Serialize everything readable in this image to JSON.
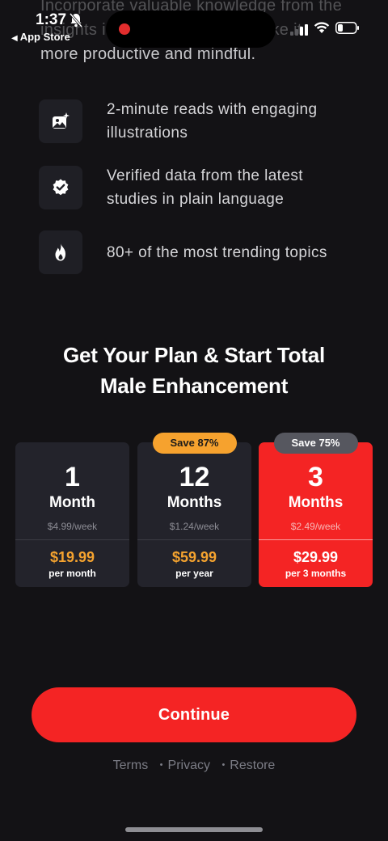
{
  "status_bar": {
    "time": "1:37",
    "back_app": "App Store"
  },
  "intro": {
    "line_top": "Incorporate valuable knowledge from the",
    "line_mid": "insights i                              ake it",
    "line_bottom": "more productive and mindful."
  },
  "features": [
    {
      "icon": "sparkle-image-icon",
      "text": "2-minute reads with engaging illustrations"
    },
    {
      "icon": "verified-badge-icon",
      "text": "Verified data from the latest studies in plain language"
    },
    {
      "icon": "fire-icon",
      "text": "80+ of the most trending topics"
    }
  ],
  "plan_title": {
    "line1": "Get Your Plan & Start Total",
    "line2": "Male Enhancement"
  },
  "plans": [
    {
      "number": "1",
      "unit": "Month",
      "weekly": "$4.99/week",
      "price": "$19.99",
      "period": "per month",
      "badge": "",
      "selected": false
    },
    {
      "number": "12",
      "unit": "Months",
      "weekly": "$1.24/week",
      "price": "$59.99",
      "period": "per year",
      "badge": "Save 87%",
      "selected": false
    },
    {
      "number": "3",
      "unit": "Months",
      "weekly": "$2.49/week",
      "price": "$29.99",
      "period": "per 3 months",
      "badge": "Save 75%",
      "selected": true
    }
  ],
  "continue_label": "Continue",
  "footer": {
    "terms": "Terms",
    "privacy": "Privacy",
    "restore": "Restore",
    "separator": "•"
  },
  "colors": {
    "background": "#131215",
    "accent_red": "#f42424",
    "price_orange": "#f5a32f",
    "card": "#23232b"
  }
}
